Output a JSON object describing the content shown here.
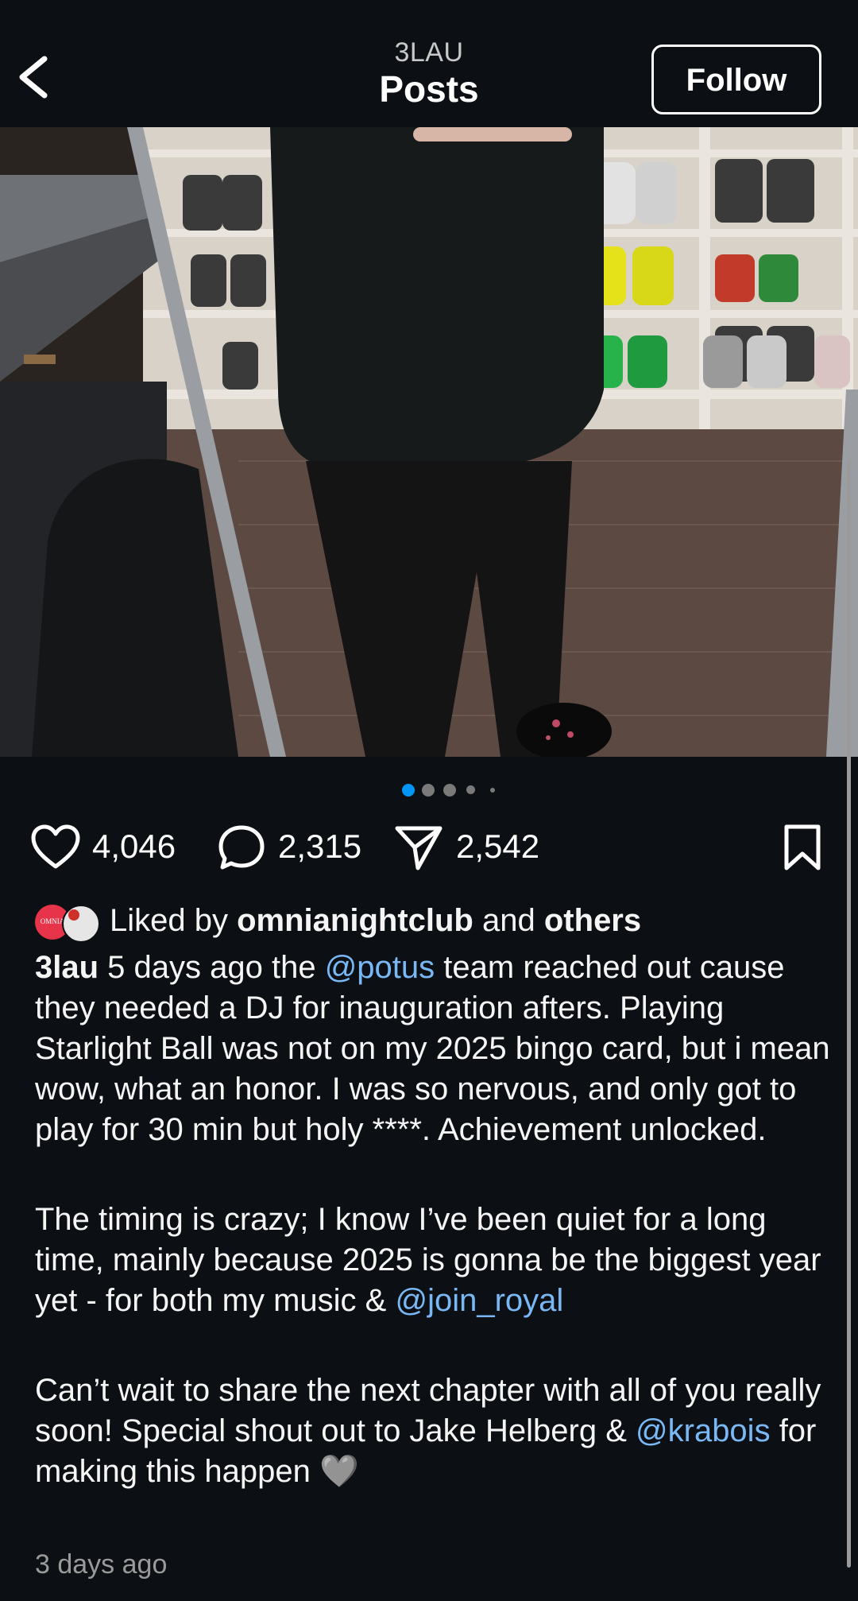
{
  "header": {
    "account": "3LAU",
    "title": "Posts",
    "follow_label": "Follow"
  },
  "carousel": {
    "total": 5,
    "active_index": 1
  },
  "actions": {
    "likes": "4,046",
    "comments": "2,315",
    "shares": "2,542"
  },
  "liked_by": {
    "prefix": "Liked by",
    "user": "omnianightclub",
    "connector": "and",
    "others": "others",
    "avatar_text": "OMNIA"
  },
  "caption": {
    "username": "3lau",
    "p1_a": " 5 days ago the ",
    "mention_potus": "@potus",
    "p1_b": " team reached out cause they needed a DJ for inauguration afters. Playing Starlight Ball was not on my 2025 bingo card, but i mean wow, what an honor. I was so nervous, and only got to play for 30 min but holy ****. Achievement unlocked.",
    "p2_a": "The timing is crazy; I know I’ve been quiet for a long time, mainly because 2025 is gonna be the biggest year yet - for both my music & ",
    "mention_royal": "@join_royal",
    "p3_a": "Can’t wait to share the next chapter with all of you really soon! Special shout out to Jake Helberg & ",
    "mention_krabois": "@krabois",
    "p3_b": " for making this happen ",
    "heart_emoji": "🩶"
  },
  "timestamp": "3 days ago",
  "colors": {
    "background": "#0c1014",
    "link": "#79b8f5",
    "active_dot": "#0095f6"
  }
}
